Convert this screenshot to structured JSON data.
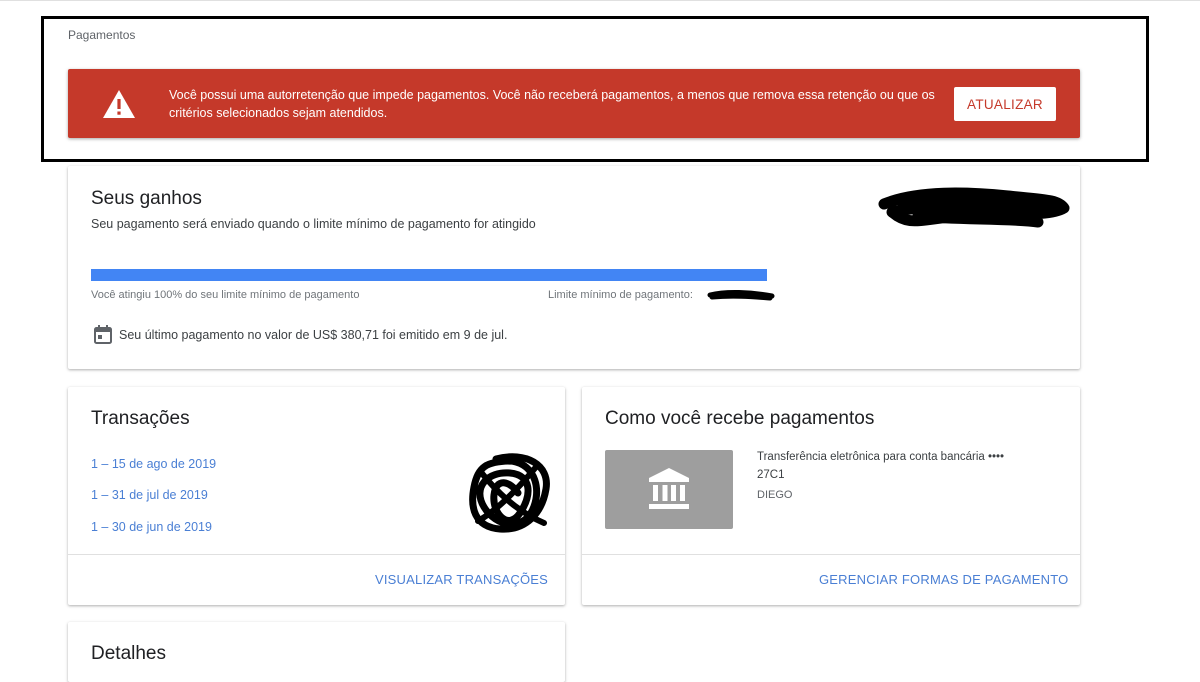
{
  "breadcrumb": "Pagamentos",
  "alert": {
    "message": "Você possui uma autorretenção que impede pagamentos. Você não receberá pagamentos, a menos que remova essa retenção ou que os critérios selecionados sejam atendidos.",
    "button_label": "ATUALIZAR",
    "icon": "warning-icon",
    "color": "#c5392a"
  },
  "earnings": {
    "title": "Seus ganhos",
    "subtitle": "Seu pagamento será enviado quando o limite mínimo de pagamento for atingido",
    "progress_percent": 100,
    "progress_label": "Você atingiu 100% do seu limite mínimo de pagamento",
    "threshold_label": "Limite mínimo de pagamento:",
    "last_payment": "Seu último pagamento no valor de US$ 380,71 foi emitido em 9 de jul.",
    "progress_color": "#4285f4"
  },
  "transactions": {
    "title": "Transações",
    "items": [
      {
        "label": "1 – 15 de ago de 2019"
      },
      {
        "label": "1 – 31 de jul de 2019"
      },
      {
        "label": "1 – 30 de jun de 2019"
      }
    ],
    "action_label": "VISUALIZAR TRANSAÇÕES"
  },
  "payment_methods": {
    "title": "Como você recebe pagamentos",
    "method_line1": "Transferência eletrônica para conta bancária ••••",
    "method_line2": "27C1",
    "account_name": "DIEGO",
    "action_label": "GERENCIAR FORMAS DE PAGAMENTO",
    "icon": "bank-icon"
  },
  "details": {
    "title": "Detalhes"
  },
  "colors": {
    "link": "#4a7fd4",
    "alert_bg": "#c5392a"
  }
}
